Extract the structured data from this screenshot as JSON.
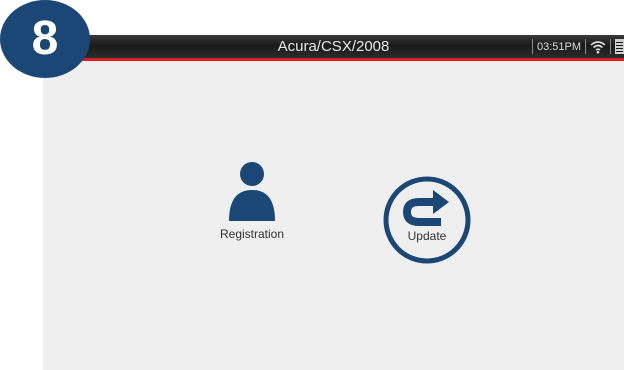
{
  "step_badge": {
    "number": "8"
  },
  "titlebar": {
    "title": "Acura/CSX/2008"
  },
  "status": {
    "time": "03:51PM",
    "wifi_icon": "wifi-icon",
    "battery_icon": "battery-icon"
  },
  "apps": [
    {
      "label": "Registration",
      "icon": "person-icon"
    },
    {
      "label": "Update",
      "icon": "update-arrow-icon"
    }
  ],
  "colors": {
    "brand_navy": "#1b4776",
    "accent_red": "#d81f26",
    "screen_bg": "#efefef"
  }
}
